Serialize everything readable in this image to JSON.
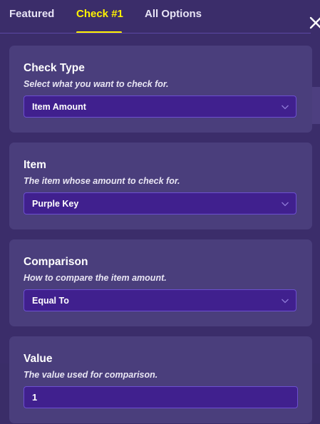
{
  "tabs": [
    {
      "label": "Featured",
      "active": false
    },
    {
      "label": "Check #1",
      "active": true
    },
    {
      "label": "All Options",
      "active": false
    }
  ],
  "close_icon": "close-icon",
  "colors": {
    "background": "#3b2d6a",
    "card": "#4a3e7c",
    "field": "#40208e",
    "field_border": "#6c4fd0",
    "active_tab": "#fff200"
  },
  "cards": {
    "check_type": {
      "title": "Check Type",
      "description": "Select what you want to check for.",
      "value": "Item Amount"
    },
    "item": {
      "title": "Item",
      "description": "The item whose amount to check for.",
      "value": "Purple Key"
    },
    "comparison": {
      "title": "Comparison",
      "description": "How to compare the item amount.",
      "value": "Equal To"
    },
    "value": {
      "title": "Value",
      "description": "The value used for comparison.",
      "value": "1"
    }
  }
}
